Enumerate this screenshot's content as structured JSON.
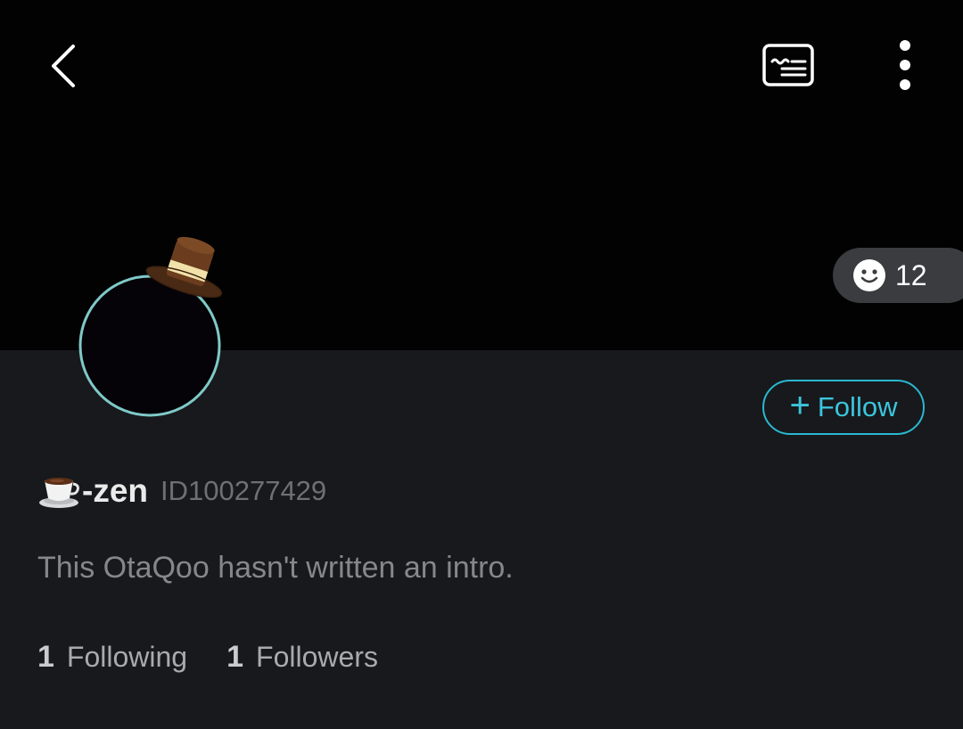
{
  "header": {
    "back_icon": "chevron-left-icon",
    "card_icon": "profile-card-icon",
    "more_icon": "more-vertical-icon"
  },
  "reaction": {
    "icon": "smiley-icon",
    "count": "12"
  },
  "profile": {
    "avatar_icon": "avatar-with-top-hat",
    "follow_label": "Follow",
    "follow_icon": "plus-icon",
    "name_emoji_icon": "coffee-cup-icon",
    "name": "-zen",
    "id": "ID100277429",
    "intro": "This OtaQoo hasn't written an intro."
  },
  "stats": {
    "following_count": "1",
    "following_label": "Following",
    "followers_count": "1",
    "followers_label": "Followers"
  },
  "colors": {
    "background": "#17191c",
    "cover": "#020202",
    "accent": "#2ab8d1",
    "avatar_ring": "#7fc9c8"
  }
}
